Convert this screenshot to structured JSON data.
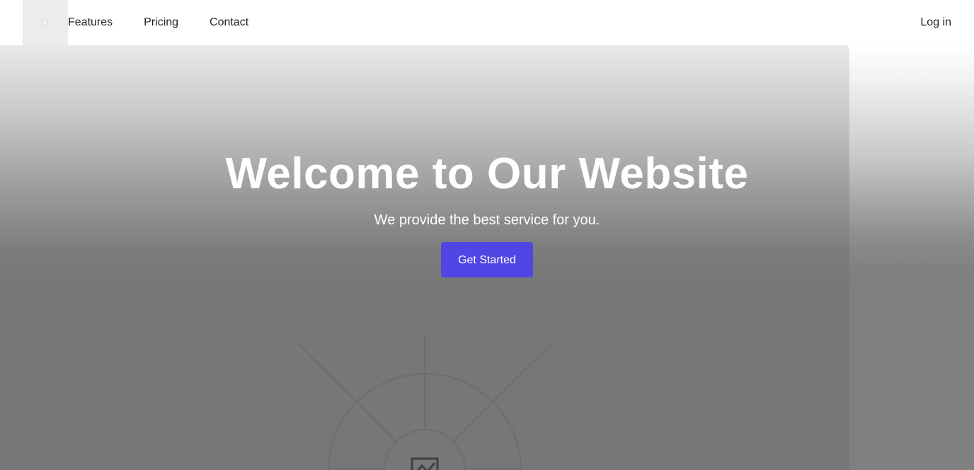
{
  "nav": {
    "links": [
      "Features",
      "Pricing",
      "Contact"
    ],
    "login_label": "Log in",
    "logo_icon": "logo-placeholder-icon"
  },
  "hero": {
    "title": "Welcome to Our Website",
    "subtitle": "We provide the best service for you.",
    "cta_label": "Get Started",
    "illustration_icon": "image-placeholder-icon"
  },
  "colors": {
    "accent": "#4f46e5",
    "nav_background": "#ffffff",
    "hero_overlay": "#777777",
    "text_on_hero": "#ffffff"
  }
}
